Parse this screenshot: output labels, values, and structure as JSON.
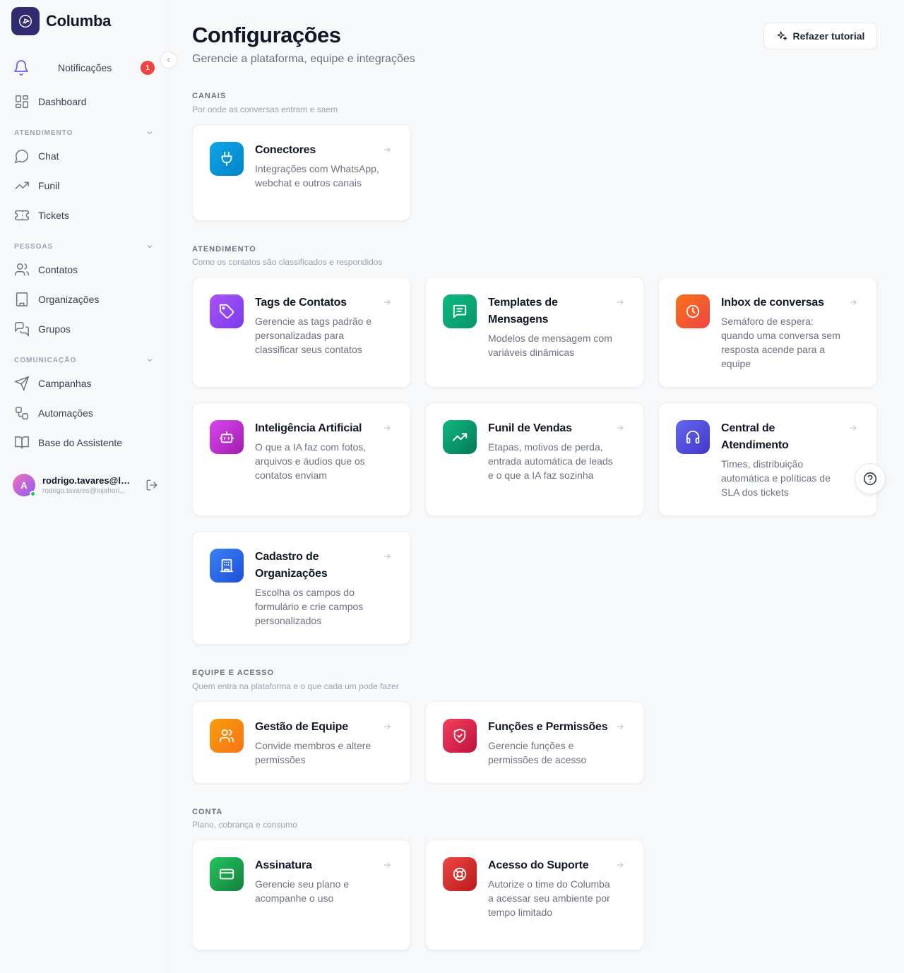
{
  "brand": {
    "name": "Columba"
  },
  "sidebar": {
    "notifications": {
      "label": "Notificações",
      "count": "1"
    },
    "dashboard": "Dashboard",
    "sections": [
      {
        "title": "ATENDIMENTO",
        "items": [
          "Chat",
          "Funil",
          "Tickets"
        ]
      },
      {
        "title": "PESSOAS",
        "items": [
          "Contatos",
          "Organizações",
          "Grupos"
        ]
      },
      {
        "title": "COMUNICAÇÃO",
        "items": [
          "Campanhas",
          "Automações",
          "Base do Assistente"
        ]
      }
    ],
    "user": {
      "initial": "A",
      "name": "rodrigo.tavares@loj...",
      "email": "rodrigo.tavares@lojahori..."
    }
  },
  "header": {
    "title": "Configurações",
    "subtitle": "Gerencie a plataforma, equipe e integrações",
    "tutorial_button": "Refazer tutorial"
  },
  "sections": [
    {
      "title": "CANAIS",
      "subtitle": "Por onde as conversas entram e saem",
      "cards": [
        {
          "title": "Conectores",
          "description": "Integrações com WhatsApp, webchat e outros canais",
          "icon": "plug-icon",
          "color": "#0ea5e9"
        }
      ]
    },
    {
      "title": "ATENDIMENTO",
      "subtitle": "Como os contatos são classificados e respondidos",
      "cards": [
        {
          "title": "Tags de Contatos",
          "description": "Gerencie as tags padrão e personalizadas para classificar seus contatos",
          "icon": "tag-icon",
          "color": "#a855f7"
        },
        {
          "title": "Templates de Mensagens",
          "description": "Modelos de mensagem com variáveis dinâmicas",
          "icon": "message-icon",
          "color": "#10b981"
        },
        {
          "title": "Inbox de conversas",
          "description": "Semáforo de espera: quando uma conversa sem resposta acende para a equipe",
          "icon": "clock-icon",
          "color": "#f97316"
        },
        {
          "title": "Inteligência Artificial",
          "description": "O que a IA faz com fotos, arquivos e áudios que os contatos enviam",
          "icon": "robot-icon",
          "color": "#d946ef"
        },
        {
          "title": "Funil de Vendas",
          "description": "Etapas, motivos de perda, entrada automática de leads e o que a IA faz sozinha",
          "icon": "trend-icon",
          "color": "#059669"
        },
        {
          "title": "Central de Atendimento",
          "description": "Times, distribuição automática e políticas de SLA dos tickets",
          "icon": "headset-icon",
          "color": "#4f46e5"
        },
        {
          "title": "Cadastro de Organizações",
          "description": "Escolha os campos do formulário e crie campos personalizados",
          "icon": "building-icon",
          "color": "#2563eb"
        }
      ]
    },
    {
      "title": "EQUIPE E ACESSO",
      "subtitle": "Quem entra na plataforma e o que cada um pode fazer",
      "cards": [
        {
          "title": "Gestão de Equipe",
          "description": "Convide membros e altere permissões",
          "icon": "users-icon",
          "color": "#f97316"
        },
        {
          "title": "Funções e Permissões",
          "description": "Gerencie funções e permissões de acesso",
          "icon": "shield-icon",
          "color": "#e11d48"
        }
      ]
    },
    {
      "title": "CONTA",
      "subtitle": "Plano, cobrança e consumo",
      "cards": [
        {
          "title": "Assinatura",
          "description": "Gerencie seu plano e acompanhe o uso",
          "icon": "credit-card-icon",
          "color": "#16a34a"
        },
        {
          "title": "Acesso do Suporte",
          "description": "Autorize o time do Columba a acessar seu ambiente por tempo limitado",
          "icon": "lifebuoy-icon",
          "color": "#dc2626"
        }
      ]
    }
  ]
}
